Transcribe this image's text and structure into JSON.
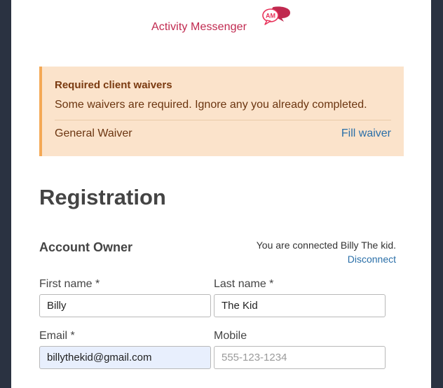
{
  "brand": {
    "name": "Activity Messenger",
    "badge": "AM",
    "colors": {
      "primary": "#c0294f",
      "secondary": "#e8325a"
    }
  },
  "alert": {
    "title": "Required client waivers",
    "message": "Some waivers are required. Ignore any you already completed.",
    "waivers": [
      {
        "name": "General Waiver",
        "action": "Fill waiver"
      }
    ]
  },
  "page": {
    "title": "Registration"
  },
  "account": {
    "section_title": "Account Owner",
    "connected_text": "You are connected Billy The kid.",
    "disconnect_label": "Disconnect"
  },
  "form": {
    "first_name": {
      "label": "First name *",
      "value": "Billy",
      "placeholder": ""
    },
    "last_name": {
      "label": "Last name *",
      "value": "The Kid",
      "placeholder": ""
    },
    "email": {
      "label": "Email *",
      "value": "billythekid@gmail.com",
      "placeholder": ""
    },
    "mobile": {
      "label": "Mobile",
      "value": "",
      "placeholder": "555-123-1234"
    }
  }
}
